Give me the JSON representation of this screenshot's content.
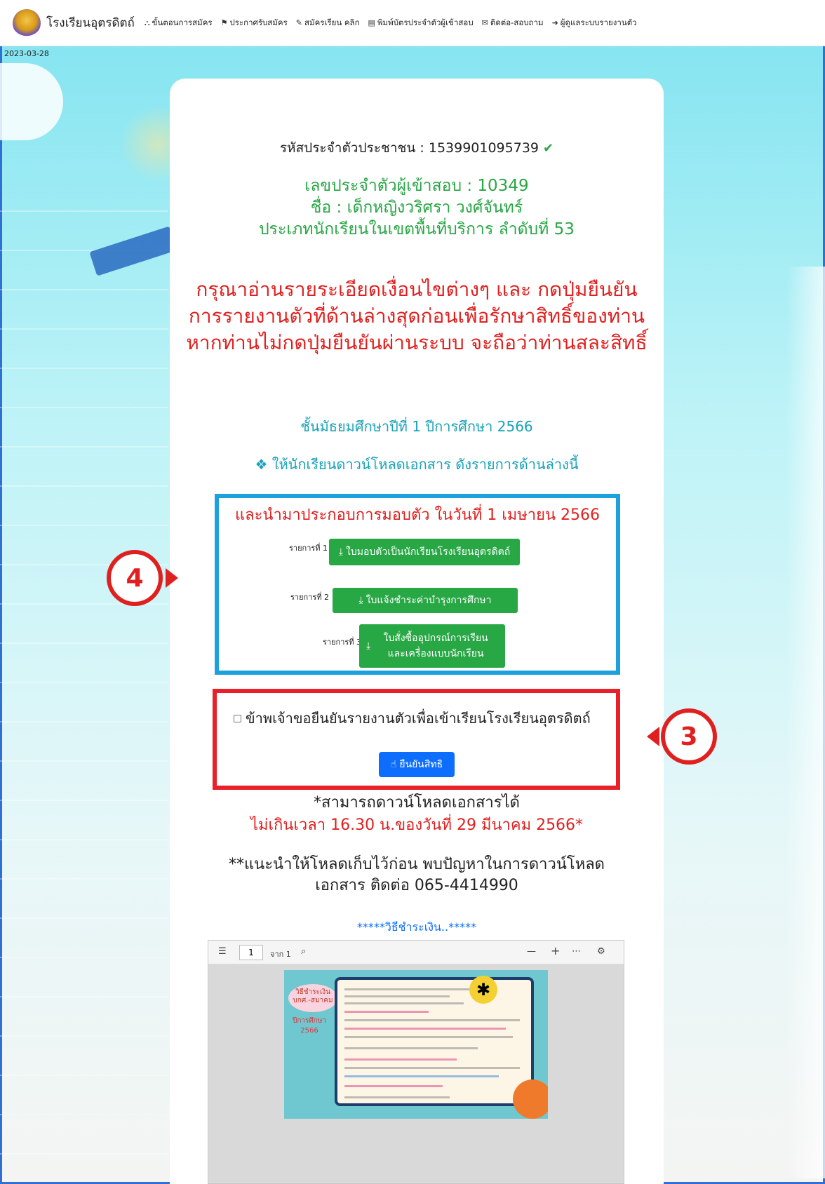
{
  "nav": {
    "brand": "โรงเรียนอุตรดิตถ์",
    "items": [
      {
        "icon": "sitemap-icon",
        "glyph": "⛬",
        "label": "ขั้นตอนการสมัคร"
      },
      {
        "icon": "announcement-icon",
        "glyph": "⚑",
        "label": "ประกาศรับสมัคร"
      },
      {
        "icon": "edit-icon",
        "glyph": "✎",
        "label": "สมัครเรียน คลิก"
      },
      {
        "icon": "id-card-icon",
        "glyph": "▤",
        "label": "พิมพ์บัตรประจำตัวผู้เข้าสอบ"
      },
      {
        "icon": "chat-icon",
        "glyph": "✉",
        "label": "ติดต่อ-สอบถาม"
      },
      {
        "icon": "login-icon",
        "glyph": "➜",
        "label": "ผู้ดูแลระบบรายงานตัว"
      }
    ]
  },
  "date": "2023-03-28",
  "student": {
    "id_line": "รหัสประจำตัวประชาชน : 1539901095739",
    "exam_no": "เลขประจำตัวผู้เข้าสอบ :  10349",
    "name": "ชื่อ : เด็กหญิงวริศรา วงศ์จันทร์",
    "type": "ประเภทนักเรียนในเขตพื้นที่บริการ   ลำดับที่ 53"
  },
  "warning": "กรุณาอ่านรายระเอียดเงื่อนไขต่างๆ และ กดปุ่มยืนยันการรายงานตัวที่ด้านล่างสุดก่อนเพื่อรักษาสิทธิ์ของท่าน หากท่านไม่กดปุ่มยืนยันผ่านระบบ จะถือว่าท่านสละสิทธิ์",
  "grade": "ชั้นมัธยมศึกษาปีที่ 1 ปีการศึกษา 2566",
  "download_intro": "❖ ให้นักเรียนดาวน์โหลดเอกสาร ดังรายการด้านล่างนี้",
  "downloads": {
    "title": "และนำมาประกอบการมอบตัว ในวันที่ 1 เมษายน 2566",
    "items": [
      {
        "label": "รายการที่ 1",
        "button": "ใบมอบตัวเป็นนักเรียนโรงเรียนอุตรดิตถ์"
      },
      {
        "label": "รายการที่ 2",
        "button": "ใบแจ้งชำระค่าบำรุงการศึกษา"
      },
      {
        "label": "รายการที่ 3",
        "button": "ใบสั่งซื้ออุปกรณ์การเรียน และเครื่องแบบนักเรียน"
      }
    ]
  },
  "confirm": {
    "checkbox_label": "ข้าพเจ้าขอยืนยันรายงานตัวเพื่อเข้าเรียนโรงเรียนอุตรดิตถ์",
    "button": "ยืนยันสิทธิ"
  },
  "notes": {
    "line1": "*สามารถดาวน์โหลดเอกสารได้",
    "line2": "ไม่เกินเวลา 16.30 น.ของวันที่ 29 มีนาคม 2566*",
    "line3": "**แนะนำให้โหลดเก็บไว้ก่อน พบปัญหาในการดาวน์โหลดเอกสาร ติดต่อ 065-4414990"
  },
  "payment_title": "*****วิธีชำระเงิน..*****",
  "pdf": {
    "page": "1",
    "of": "จาก 1",
    "doc_bubble": "วิธีชำระเงิน บกศ.-สมาคม",
    "doc_year": "ปีการศึกษา 2566"
  },
  "callouts": {
    "left": "4",
    "right": "3"
  },
  "colors": {
    "green": "#28a745",
    "red": "#e0201f",
    "teal": "#17a2b8",
    "blue": "#0d6efd",
    "box_blue": "#1da1dc"
  }
}
